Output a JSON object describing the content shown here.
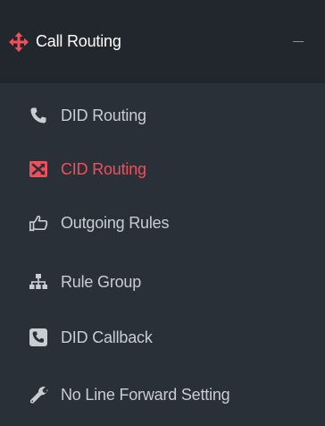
{
  "section": {
    "title": "Call Routing",
    "icon": "arrows-move-icon",
    "collapse_icon": "minus-icon",
    "accent_color": "#f0505a"
  },
  "items": [
    {
      "label": "DID Routing",
      "icon": "phone-icon",
      "active": false
    },
    {
      "label": "CID Routing",
      "icon": "random-arrows-icon",
      "active": true
    },
    {
      "label": "Outgoing Rules",
      "icon": "hand-pointing-icon",
      "active": false
    },
    {
      "label": "Rule Group",
      "icon": "sitemap-icon",
      "active": false
    },
    {
      "label": "DID Callback",
      "icon": "phone-square-icon",
      "active": false
    },
    {
      "label": "No Line Forward Setting",
      "icon": "wrench-icon",
      "active": false
    }
  ]
}
